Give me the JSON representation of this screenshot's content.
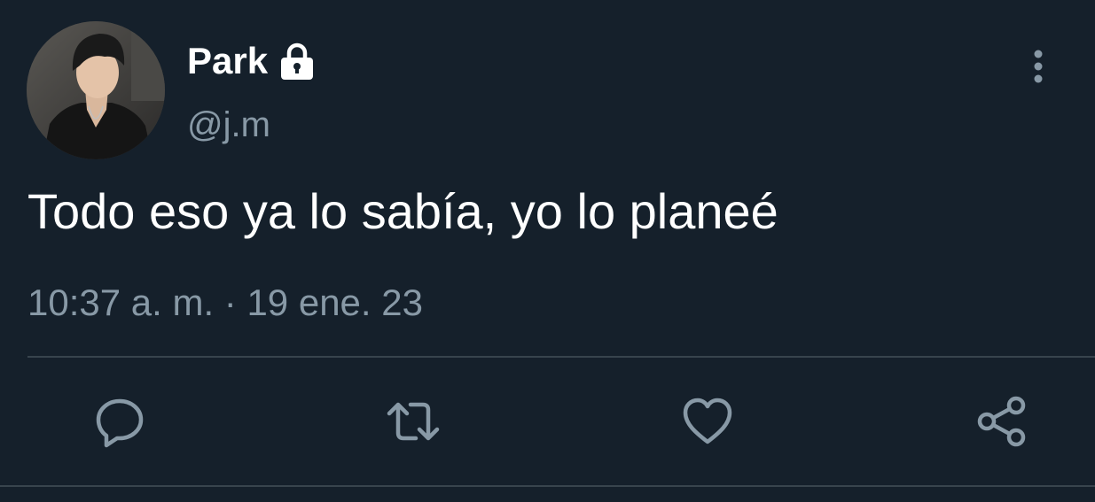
{
  "tweet": {
    "display_name": "Park",
    "handle": "@j.m",
    "text": "Todo eso ya lo sabía, yo lo planeé",
    "timestamp": "10:37 a. m. · 19 ene. 23",
    "protected_icon": "lock-icon",
    "avatar": "profile-photo"
  },
  "actions": [
    {
      "name": "reply",
      "icon": "comment-icon"
    },
    {
      "name": "retweet",
      "icon": "retweet-icon"
    },
    {
      "name": "like",
      "icon": "heart-icon"
    },
    {
      "name": "share",
      "icon": "share-icon"
    }
  ],
  "menu": {
    "icon": "more-options-icon"
  },
  "colors": {
    "background": "#15202b",
    "text_primary": "#ffffff",
    "text_secondary": "#8899a6",
    "divider": "#38444d"
  }
}
